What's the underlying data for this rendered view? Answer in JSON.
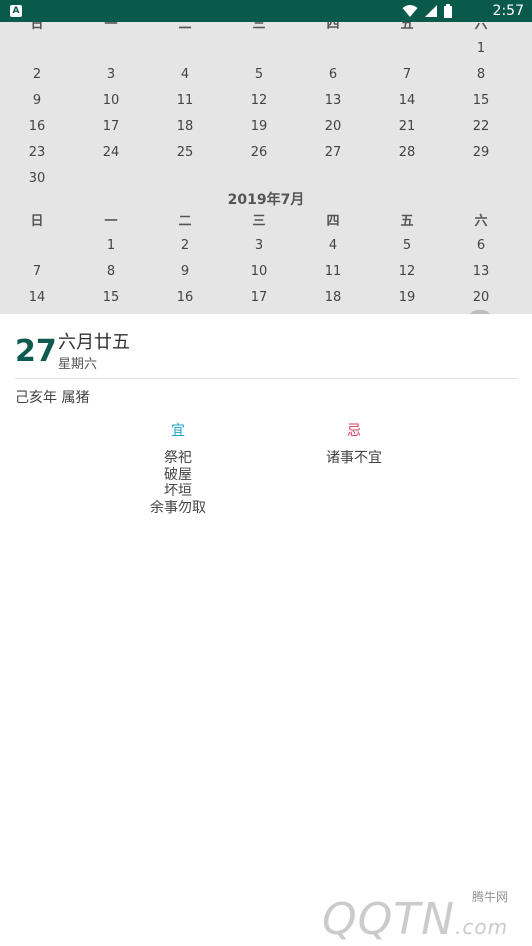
{
  "status_bar": {
    "app_badge": "A",
    "time": "2:57"
  },
  "weekdays": [
    "日",
    "一",
    "二",
    "三",
    "四",
    "五",
    "六"
  ],
  "calendar": {
    "june_rows": [
      [
        "",
        "",
        "",
        "",
        "",
        "",
        "1"
      ],
      [
        "2",
        "3",
        "4",
        "5",
        "6",
        "7",
        "8"
      ],
      [
        "9",
        "10",
        "11",
        "12",
        "13",
        "14",
        "15"
      ],
      [
        "16",
        "17",
        "18",
        "19",
        "20",
        "21",
        "22"
      ],
      [
        "23",
        "24",
        "25",
        "26",
        "27",
        "28",
        "29"
      ],
      [
        "30",
        "",
        "",
        "",
        "",
        "",
        ""
      ]
    ],
    "july_title": "2019年7月",
    "july_rows": [
      [
        "",
        "1",
        "2",
        "3",
        "4",
        "5",
        "6"
      ],
      [
        "7",
        "8",
        "9",
        "10",
        "11",
        "12",
        "13"
      ],
      [
        "14",
        "15",
        "16",
        "17",
        "18",
        "19",
        "20"
      ]
    ]
  },
  "detail": {
    "day": "27",
    "lunar_date": "六月廿五",
    "weekday": "星期六",
    "year_info": "己亥年  属猪",
    "yi_label": "宜",
    "ji_label": "忌",
    "yi_items": [
      "祭祀",
      "破屋",
      "坏垣",
      "余事勿取"
    ],
    "ji_items": [
      "诸事不宜"
    ]
  },
  "watermark": {
    "brand": "QQTN",
    "suffix": ".com",
    "cn_name": "腾牛网"
  },
  "colors": {
    "status_bar": "#0a5a4c",
    "day_number": "#0f5a4e",
    "yi": "#1aa3c8",
    "ji": "#d63d5a"
  }
}
